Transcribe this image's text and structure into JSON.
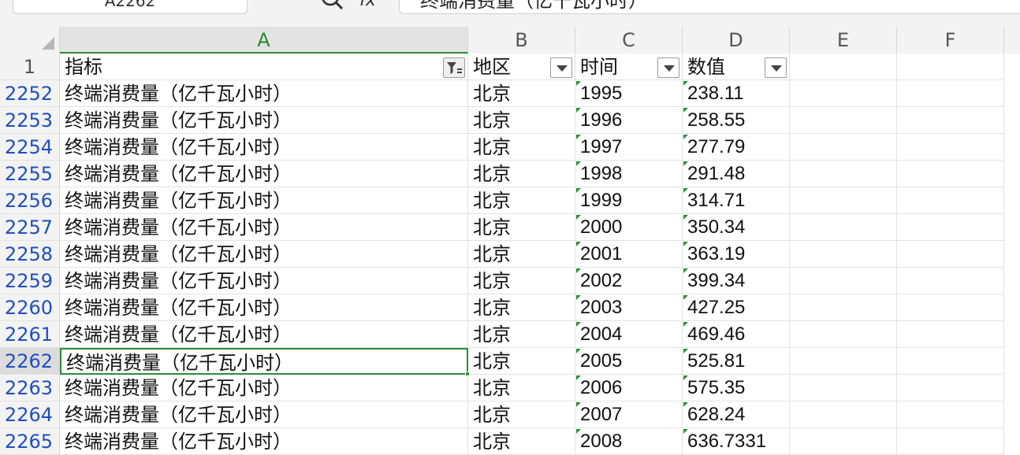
{
  "formula_bar": {
    "name_box": "A2262",
    "fx_label": "fx",
    "formula": "终端消费量（亿千瓦小时）"
  },
  "columns": [
    "A",
    "B",
    "C",
    "D",
    "E",
    "F"
  ],
  "header_row": {
    "row_number": "1",
    "cells": [
      "指标",
      "地区",
      "时间",
      "数值"
    ]
  },
  "rows": [
    {
      "num": "2252",
      "indicator": "终端消费量（亿千瓦小时）",
      "region": "北京",
      "year": "1995",
      "value": "238.11"
    },
    {
      "num": "2253",
      "indicator": "终端消费量（亿千瓦小时）",
      "region": "北京",
      "year": "1996",
      "value": "258.55"
    },
    {
      "num": "2254",
      "indicator": "终端消费量（亿千瓦小时）",
      "region": "北京",
      "year": "1997",
      "value": "277.79"
    },
    {
      "num": "2255",
      "indicator": "终端消费量（亿千瓦小时）",
      "region": "北京",
      "year": "1998",
      "value": "291.48"
    },
    {
      "num": "2256",
      "indicator": "终端消费量（亿千瓦小时）",
      "region": "北京",
      "year": "1999",
      "value": "314.71"
    },
    {
      "num": "2257",
      "indicator": "终端消费量（亿千瓦小时）",
      "region": "北京",
      "year": "2000",
      "value": "350.34"
    },
    {
      "num": "2258",
      "indicator": "终端消费量（亿千瓦小时）",
      "region": "北京",
      "year": "2001",
      "value": "363.19"
    },
    {
      "num": "2259",
      "indicator": "终端消费量（亿千瓦小时）",
      "region": "北京",
      "year": "2002",
      "value": "399.34"
    },
    {
      "num": "2260",
      "indicator": "终端消费量（亿千瓦小时）",
      "region": "北京",
      "year": "2003",
      "value": "427.25"
    },
    {
      "num": "2261",
      "indicator": "终端消费量（亿千瓦小时）",
      "region": "北京",
      "year": "2004",
      "value": "469.46"
    },
    {
      "num": "2262",
      "indicator": "终端消费量（亿千瓦小时）",
      "region": "北京",
      "year": "2005",
      "value": "525.81"
    },
    {
      "num": "2263",
      "indicator": "终端消费量（亿千瓦小时）",
      "region": "北京",
      "year": "2006",
      "value": "575.35"
    },
    {
      "num": "2264",
      "indicator": "终端消费量（亿千瓦小时）",
      "region": "北京",
      "year": "2007",
      "value": "628.24"
    },
    {
      "num": "2265",
      "indicator": "终端消费量（亿千瓦小时）",
      "region": "北京",
      "year": "2008",
      "value": "636.7331"
    }
  ],
  "selection": {
    "cell": "A2262",
    "active_column": "A",
    "active_row": "2262"
  },
  "colors": {
    "accent": "#2e8b37",
    "row_number": "#1f4fbf"
  },
  "icons": {
    "search": "search-icon",
    "filter_active": "filter-active-icon",
    "filter": "dropdown-arrow-icon"
  }
}
